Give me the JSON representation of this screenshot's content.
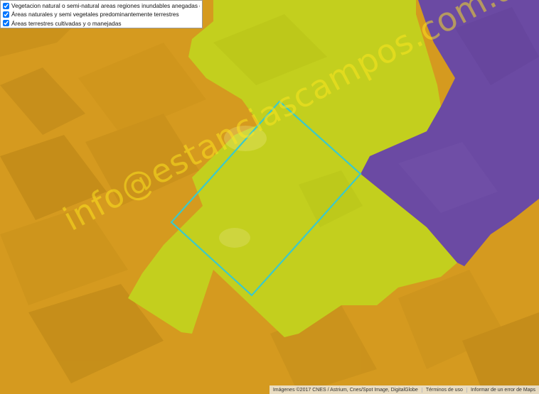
{
  "legend": {
    "items": [
      {
        "label": "Vegetacion natural o semi-natural areas regiones inundables anegadas o acuaticas",
        "checked": true,
        "color": "#6a4aa6"
      },
      {
        "label": "Áreas naturales y semi vegetales predominantemente terrestres",
        "checked": true,
        "color": "#c6d21c"
      },
      {
        "label": "Áreas terrestres cultivadas y o manejadas",
        "checked": true,
        "color": "#d89a1a"
      }
    ]
  },
  "watermark": "info@estanciascampos.com.ar",
  "attribution": {
    "imagery": "Imágenes ©2017 CNES / Astrium, Cnes/Spot Image, DigitalGlobe",
    "terms": "Términos de uso",
    "report": "Informar de un error de Maps"
  },
  "colors": {
    "cultivated": "#d59a1f",
    "natural_terrestrial": "#c3cf1e",
    "wetland": "#6b4aa3",
    "parcel_outline": "#3cc9c9"
  }
}
